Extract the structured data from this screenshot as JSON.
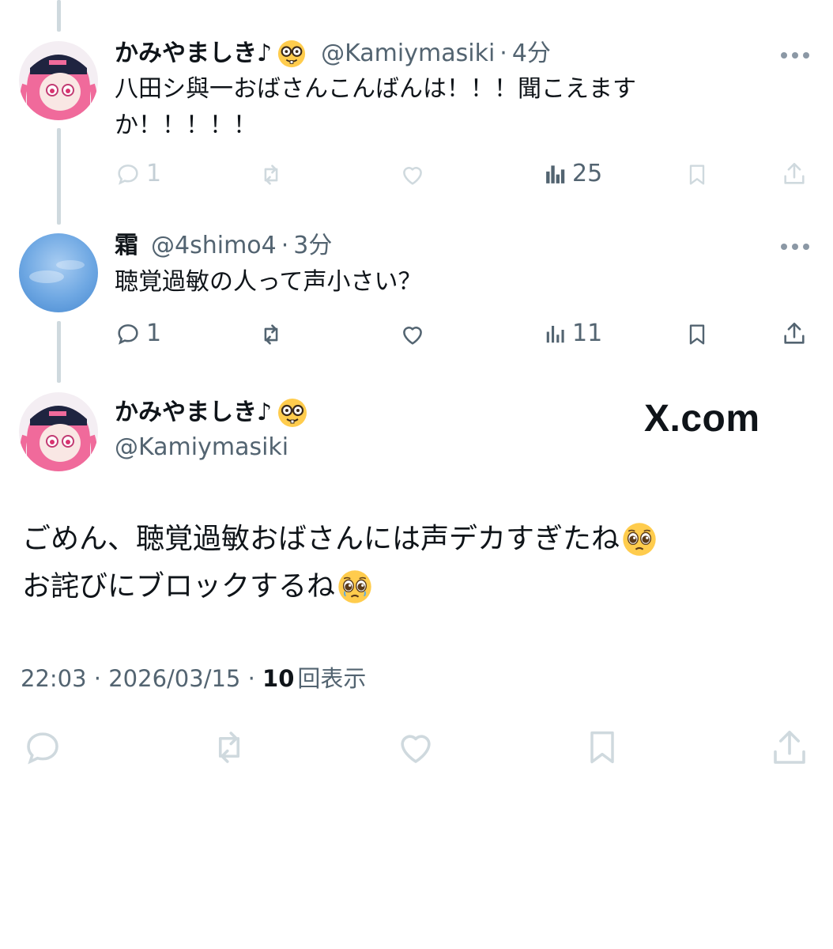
{
  "thread": [
    {
      "author_name": "かみやましき♪",
      "author_emoji": "nerd-face-emoji",
      "handle": "@Kamiymasiki",
      "separator": "·",
      "time": "4分",
      "text_lines": [
        "八田シ與一おばさんこんばんは！！！聞こえます",
        "か！！！！！"
      ],
      "replies": "1",
      "views": "25",
      "faded": true
    },
    {
      "author_name": "霜",
      "handle": "@4shimo4",
      "separator": "·",
      "time": "3分",
      "text_lines": [
        "聴覚過敏の人って声小さい？"
      ],
      "replies": "1",
      "views": "11",
      "faded": false
    }
  ],
  "main_post": {
    "author_name": "かみやましき♪",
    "author_emoji": "nerd-face-emoji",
    "handle": "@Kamiymasiki",
    "text_lines": [
      {
        "text": "ごめん、聴覚過敏おばさんには声デカすぎたね",
        "emoji": "pleading-face-emoji"
      },
      {
        "text": "お詫びにブロックするね",
        "emoji": "pleading-face-emoji"
      }
    ],
    "time": "22:03",
    "date": "2026/03/15",
    "separator": "·",
    "views_count": "10",
    "views_label": "回表示"
  },
  "watermark": "X.com",
  "colors": {
    "text_primary": "#0f1419",
    "text_secondary": "#536471",
    "thread_line": "#cfd9de",
    "faded_icon": "#cfd9de",
    "avatar_hair": "#f06a9b",
    "avatar_cap": "#1f2440",
    "sky": "#6fa8e3"
  }
}
